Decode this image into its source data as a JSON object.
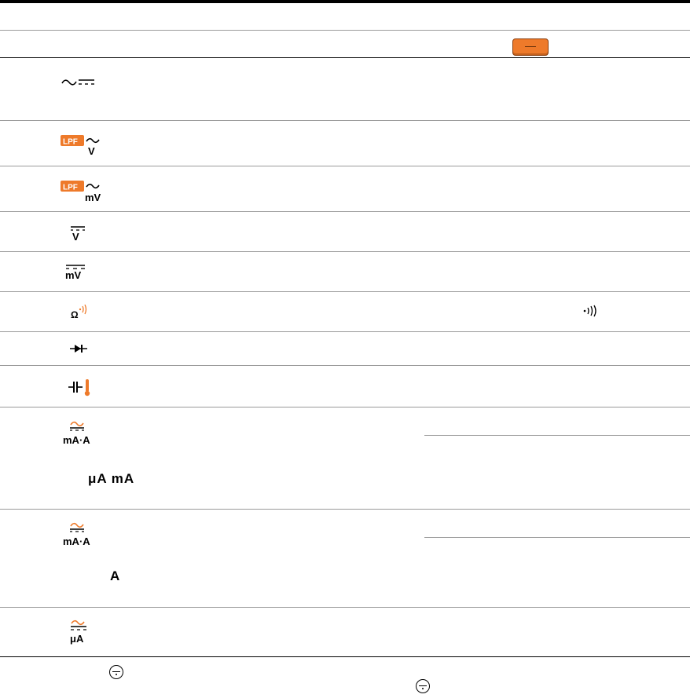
{
  "rows": [
    {
      "name": "row-header",
      "symbol": "orange-button-icon"
    },
    {
      "name": "row-ac-dc",
      "symbol": "ac-dc-icon"
    },
    {
      "name": "row-lpf-acv",
      "symbol": "lpf-ac-v-icon",
      "unit": "V"
    },
    {
      "name": "row-lpf-acmv",
      "symbol": "lpf-ac-mv-icon",
      "unit": "mV"
    },
    {
      "name": "row-dcv",
      "symbol": "dc-v-icon",
      "unit": "V"
    },
    {
      "name": "row-dcmv",
      "symbol": "dc-mv-icon",
      "unit": "mV"
    },
    {
      "name": "row-ohm-continuity",
      "symbol": "ohm-continuity-icon",
      "unit": "Ω"
    },
    {
      "name": "row-diode",
      "symbol": "diode-icon"
    },
    {
      "name": "row-capacitance-temp",
      "symbol": "capacitor-thermometer-icon"
    },
    {
      "name": "row-ma-a-1",
      "symbol": "ac-dc-ma-a-icon",
      "unit": "mA·A"
    },
    {
      "name": "row-ma-a-2",
      "symbol": "ac-dc-ma-a-icon",
      "unit": "mA·A"
    },
    {
      "name": "row-ua",
      "symbol": "ac-dc-ua-icon",
      "unit": "μA"
    },
    {
      "name": "row-footer",
      "symbol": "rotary-knob-icon"
    }
  ],
  "labels": {
    "ua_ma": "μA  mA",
    "a": "A",
    "v": "V",
    "mv": "mV",
    "ohm": "Ω",
    "ma_a": "mA·A",
    "ua": "μA",
    "lpf": "LPF"
  },
  "colors": {
    "accent": "#ee7a2a",
    "rule": "#000000",
    "subrule": "#9a9a9a"
  }
}
